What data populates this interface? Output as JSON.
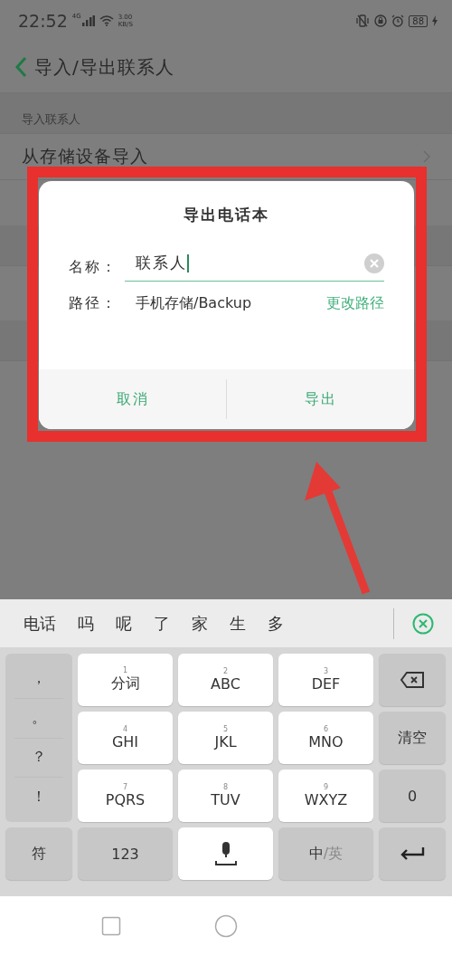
{
  "status_bar": {
    "time": "22:52",
    "network": "4G",
    "speed": "3.00",
    "speed_unit": "KB/S",
    "battery": "88"
  },
  "header": {
    "title": "导入/导出联系人"
  },
  "sections": [
    {
      "title": "导入联系人",
      "items": [
        {
          "label": "从存储设备导入"
        }
      ]
    }
  ],
  "dialog": {
    "title": "导出电话本",
    "name_label": "名称：",
    "name_value": "联系人",
    "path_label": "路径：",
    "path_value": "手机存储/Backup",
    "change_path": "更改路径",
    "buttons": [
      {
        "label": "取消"
      },
      {
        "label": "导出"
      }
    ]
  },
  "keyboard": {
    "candidates": [
      "电话",
      "吗",
      "呢",
      "了",
      "家",
      "生",
      "多"
    ],
    "punctuation": [
      "，",
      "。",
      "？",
      "！"
    ],
    "keys": [
      {
        "digit": "1",
        "label": "分词"
      },
      {
        "digit": "2",
        "label": "ABC"
      },
      {
        "digit": "3",
        "label": "DEF"
      },
      {
        "digit": "4",
        "label": "GHI"
      },
      {
        "digit": "5",
        "label": "JKL"
      },
      {
        "digit": "6",
        "label": "MNO"
      },
      {
        "digit": "7",
        "label": "PQRS"
      },
      {
        "digit": "8",
        "label": "TUV"
      },
      {
        "digit": "9",
        "label": "WXYZ"
      }
    ],
    "clear": "清空",
    "zero": "0",
    "symbols": "符",
    "numbers": "123",
    "lang_primary": "中",
    "lang_secondary": "/英"
  }
}
